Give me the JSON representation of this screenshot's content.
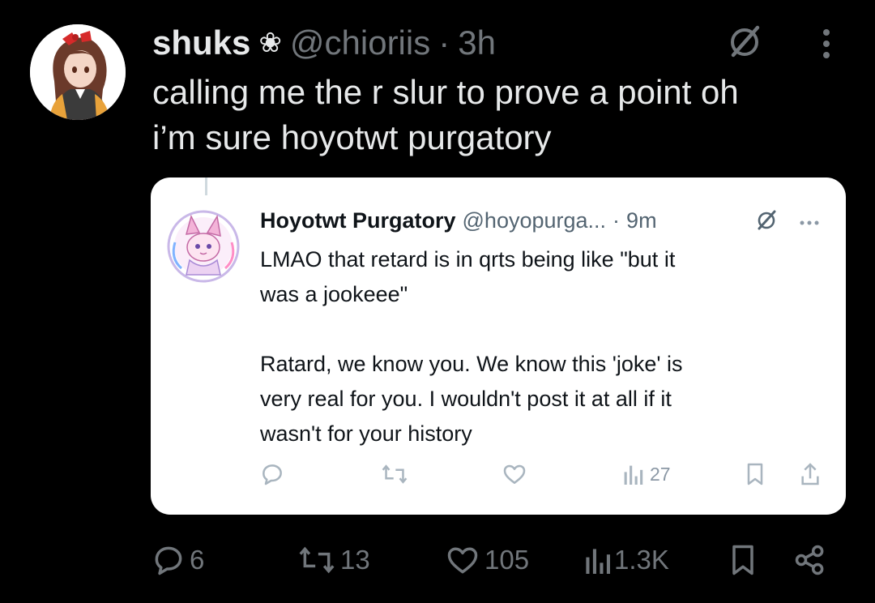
{
  "tweet": {
    "display_name": "shuks",
    "name_emoji": "❀",
    "handle": "@chioriis",
    "separator": "·",
    "time": "3h",
    "text_lines": [
      "calling me the r slur to prove a point oh",
      "i’m sure hoyotwt purgatory"
    ],
    "icons": {
      "grok": "grok-icon",
      "more": "more-options-icon"
    }
  },
  "quoted_tweet": {
    "display_name": "Hoyotwt Purgatory",
    "handle": "@hoyopurga...",
    "separator": "·",
    "time": "9m",
    "paragraph_1_lines": [
      "LMAO that retard is in qrts being like \"but it",
      "was a jookeee\""
    ],
    "paragraph_2_lines": [
      "Ratard, we know you. We know this 'joke' is",
      "very real for you. I wouldn't post it at all if it",
      "wasn't for your history"
    ],
    "actions": {
      "views": "27"
    },
    "colors": {
      "background": "#ffffff",
      "text": "#0f1419",
      "muted": "#536471",
      "icon": "#a9b5bf"
    }
  },
  "actions": {
    "replies": "6",
    "reposts": "13",
    "likes": "105",
    "views": "1.3K"
  },
  "colors": {
    "background": "#000000",
    "text": "#e7e9ea",
    "muted": "#71767b"
  }
}
